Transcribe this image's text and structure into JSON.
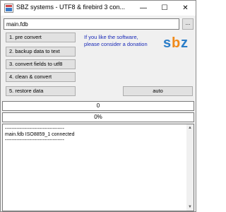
{
  "window": {
    "title": "SBZ systems - UTF8 & firebird 3 con...",
    "minimize_glyph": "—",
    "maximize_glyph": "☐",
    "close_glyph": "✕"
  },
  "file": {
    "value": "main.fdb",
    "browse_label": "..."
  },
  "actions": [
    {
      "label": "1. pre convert"
    },
    {
      "label": "2. backup data to text"
    },
    {
      "label": "3. convert fields to utf8"
    },
    {
      "label": "4. clean & convert"
    },
    {
      "label": "5. restore data"
    }
  ],
  "auto_label": "auto",
  "donate": {
    "line1": "If you like the software,",
    "line2": "please consider a donation",
    "color": "#1a2bb8"
  },
  "logo": {
    "text_s": "s",
    "text_b": "b",
    "text_z": "z",
    "colors": {
      "s": "#2a7dc8",
      "b": "#f08a1a",
      "z": "#2a7dc8"
    }
  },
  "progress": {
    "counter": "0",
    "percent": "0%",
    "percent_value": 0
  },
  "log": {
    "lines": [
      "------------------------------------",
      "main.fdb ISO8859_1 connected",
      "------------------------------------"
    ]
  }
}
